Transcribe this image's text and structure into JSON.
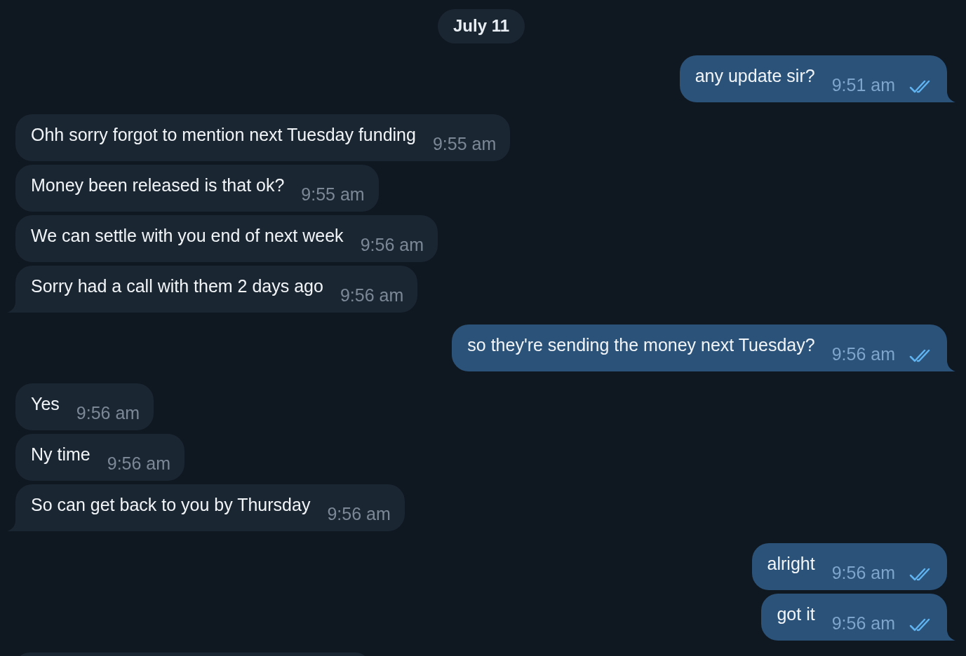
{
  "date_badge": "July 11",
  "messages": [
    {
      "kind": "outgoing",
      "text": "any update sir?",
      "time": "9:51 am",
      "read": true,
      "tail": true
    },
    {
      "kind": "incoming",
      "text": "Ohh sorry forgot to mention next Tuesday funding",
      "time": "9:55 am",
      "tail": false
    },
    {
      "kind": "incoming",
      "text": "Money been released is that ok?",
      "time": "9:55 am",
      "tail": false
    },
    {
      "kind": "incoming",
      "text": "We can settle with you end of next week",
      "time": "9:56 am",
      "tail": false
    },
    {
      "kind": "incoming",
      "text": "Sorry had a call with them 2 days ago",
      "time": "9:56 am",
      "tail": true
    },
    {
      "kind": "outgoing",
      "text": "so they're sending the money next Tuesday?",
      "time": "9:56 am",
      "read": true,
      "tail": true
    },
    {
      "kind": "incoming",
      "text": "Yes",
      "time": "9:56 am",
      "tail": false
    },
    {
      "kind": "incoming",
      "text": "Ny time",
      "time": "9:56 am",
      "tail": false
    },
    {
      "kind": "incoming",
      "text": "So can get back to you by Thursday",
      "time": "9:56 am",
      "tail": true
    },
    {
      "kind": "outgoing",
      "text": "alright",
      "time": "9:56 am",
      "read": true,
      "tail": false
    },
    {
      "kind": "outgoing",
      "text": "got it",
      "time": "9:56 am",
      "read": true,
      "tail": true
    },
    {
      "kind": "partial"
    }
  ]
}
